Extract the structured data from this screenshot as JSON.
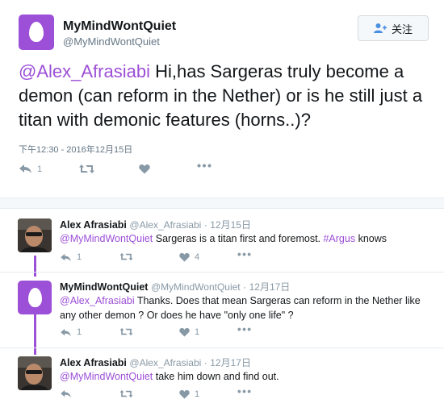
{
  "main_tweet": {
    "display_name": "MyMindWontQuiet",
    "handle": "@MyMindWontQuiet",
    "follow_label": "关注",
    "mention": "@Alex_Afrasiabi",
    "text": " Hi,has Sargeras truly become a demon (can reform in the Nether) or is he still just a titan with demonic features (horns..)?",
    "timestamp": "下午12:30 - 2016年12月15日",
    "reply_count": "1",
    "retweet_count": "",
    "like_count": ""
  },
  "replies": [
    {
      "display_name": "Alex Afrasiabi",
      "handle": "@Alex_Afrasiabi",
      "date": "12月15日",
      "mention": "@MyMindWontQuiet",
      "text_before": " Sargeras is a titan first and foremost. ",
      "hashtag": "#Argus",
      "text_after": " knows",
      "reply_count": "1",
      "retweet_count": "",
      "like_count": "4",
      "avatar": "photo-avatar"
    },
    {
      "display_name": "MyMindWontQuiet",
      "handle": "@MyMindWontQuiet",
      "date": "12月17日",
      "mention": "@Alex_Afrasiabi",
      "text_before": " Thanks. Does that mean Sargeras can reform in the Nether like any other demon ? Or does he have \"only one life\" ?",
      "reply_count": "1",
      "retweet_count": "",
      "like_count": "1",
      "avatar": "egg-avatar"
    },
    {
      "display_name": "Alex Afrasiabi",
      "handle": "@Alex_Afrasiabi",
      "date": "12月17日",
      "mention": "@MyMindWontQuiet",
      "text_before": " take him down and find out.",
      "reply_count": "",
      "retweet_count": "",
      "like_count": "1",
      "avatar": "photo-avatar"
    }
  ],
  "meta_separator": "·",
  "icons": {
    "reply": "reply-icon",
    "retweet": "retweet-icon",
    "like": "heart-icon",
    "more": "more-icon",
    "follow": "add-user-icon"
  },
  "colors": {
    "accent": "#9c4fd7",
    "text": "#14171a",
    "muted": "#8899a6"
  }
}
